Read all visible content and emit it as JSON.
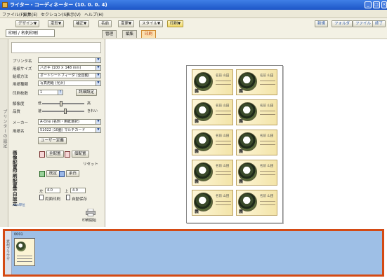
{
  "window": {
    "title": "ライター・コーディネーター (10. 0. 0. 4)",
    "buttons": [
      "_",
      "□",
      "×"
    ]
  },
  "menu": [
    "ファイル(F)",
    "編集(E)",
    "セクション(S)",
    "表示(V)",
    "ヘルプ(H)"
  ],
  "toolbar": {
    "buttons": [
      "デザイン▼",
      "変形▼",
      "補正▼",
      "名前",
      "変更▼",
      "スタイル▼",
      "印刷▼"
    ],
    "right_buttons": [
      "新規",
      "フォルダ",
      "ファイル",
      "終了"
    ],
    "mode_tab": "印刷 / 名刺印刷",
    "doc_tabs": [
      "管理",
      "編集",
      "印刷"
    ]
  },
  "side_tab": {
    "label": "プリンターの設定"
  },
  "panel": {
    "rows": [
      {
        "label": "プリンタ名",
        "value": ""
      },
      {
        "label": "用紙サイズ",
        "value": "ハガキ (100 × 148 mm)"
      },
      {
        "label": "給紙方法",
        "value": "オートシートフィーダ (全自動)"
      },
      {
        "label": "用紙種類",
        "value": "写真用紙 (光沢)"
      },
      {
        "label": "印刷枚数",
        "value": "1"
      }
    ],
    "detail_button": "詳細設定",
    "sliders": [
      {
        "label": "解像度",
        "left": "低",
        "right": "高",
        "level": 0.45
      },
      {
        "label": "品質",
        "left": "速",
        "right": "きれい",
        "level": 0.55
      }
    ],
    "maker": {
      "label": "メーカー",
      "value": "A-One (名刺・用紙選択)"
    },
    "paper_name": {
      "label": "用紙名",
      "value": "51022 (10面) マルチカード"
    },
    "user_define": "ユーザー定義",
    "image_layout": {
      "label": "画像配置",
      "btn1": "全配置",
      "btn2": "個配置",
      "reset": "リセット"
    },
    "print_layout": {
      "label": "印刷配置",
      "btn1": "既定",
      "btn2": "余白"
    },
    "margin": {
      "label": "余白設定",
      "left_label": "左",
      "left_value": "4.0",
      "top_label": "上",
      "top_value": "4.0",
      "sub": "mm単位",
      "chk1": "両面印刷",
      "chk2": "自動保存"
    },
    "print_button": "印刷開始"
  },
  "card": {
    "name_text": "名前 山田",
    "kanji": "義"
  },
  "bottom": {
    "side_label": "素材ブラウザ",
    "thumb_number": "0001"
  }
}
